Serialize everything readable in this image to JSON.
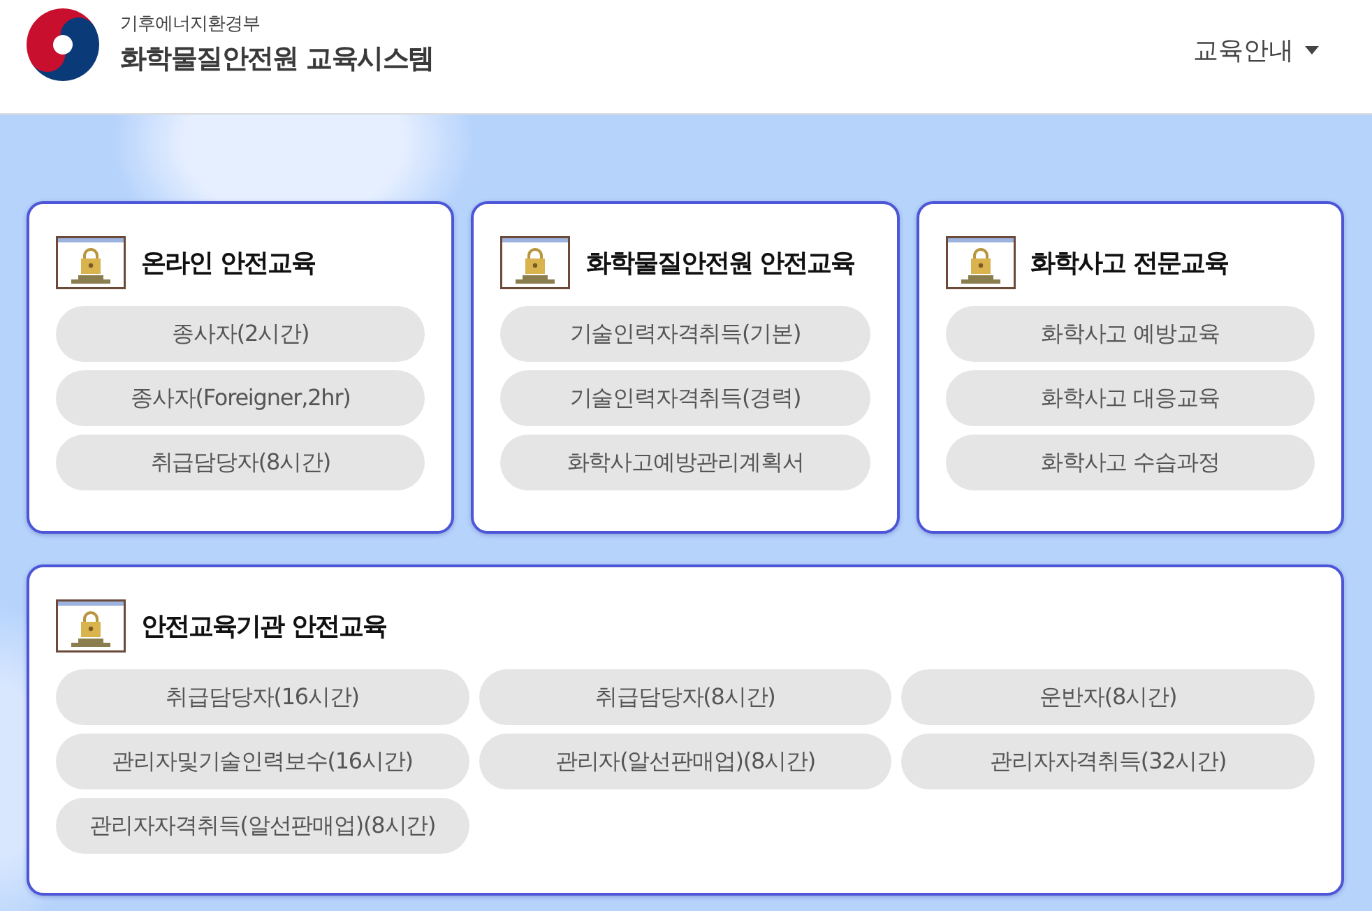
{
  "header": {
    "ministry": "기후에너지환경부",
    "site_title": "화학물질안전원 교육시스템",
    "menu": {
      "label": "교육안내"
    }
  },
  "cards": [
    {
      "title": "온라인 안전교육",
      "links": [
        "종사자(2시간)",
        "종사자(Foreigner,2hr)",
        "취급담당자(8시간)"
      ]
    },
    {
      "title": "화학물질안전원 안전교육",
      "links": [
        "기술인력자격취득(기본)",
        "기술인력자격취득(경력)",
        "화학사고예방관리계획서"
      ]
    },
    {
      "title": "화학사고 전문교육",
      "links": [
        "화학사고 예방교육",
        "화학사고 대응교육",
        "화학사고 수습과정"
      ]
    }
  ],
  "wide_card": {
    "title": "안전교육기관 안전교육",
    "links": [
      "취급담당자(16시간)",
      "취급담당자(8시간)",
      "운반자(8시간)",
      "관리자및기술인력보수(16시간)",
      "관리자(알선판매업)(8시간)",
      "관리자자격취득(32시간)",
      "관리자자격취득(알선판매업)(8시간)"
    ]
  }
}
